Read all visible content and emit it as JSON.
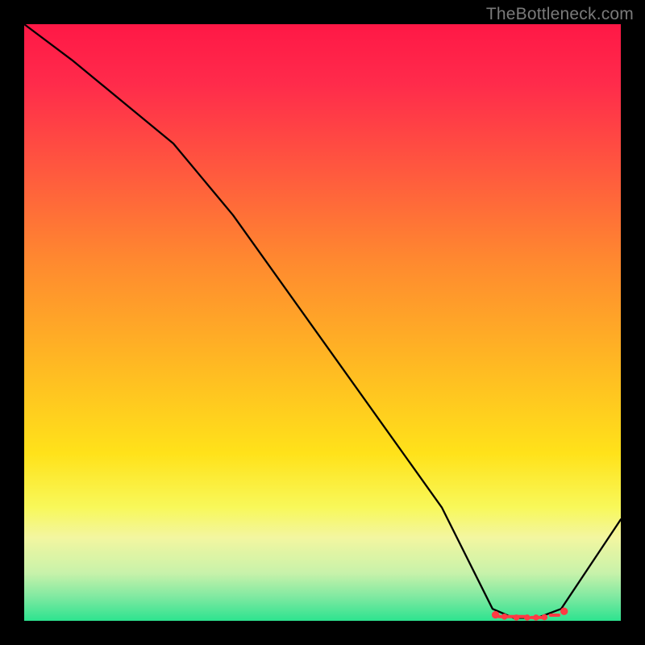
{
  "watermark": "TheBottleneck.com",
  "chart_data": {
    "type": "line",
    "title": "",
    "xlabel": "",
    "ylabel": "",
    "xlim": [
      0,
      100
    ],
    "ylim": [
      0,
      100
    ],
    "grid": false,
    "legend": false,
    "background_gradient": {
      "direction": "vertical",
      "stops": [
        {
          "pos": 0.0,
          "color": "#ff1846"
        },
        {
          "pos": 0.55,
          "color": "#ffe21a"
        },
        {
          "pos": 0.86,
          "color": "#f3f6a0"
        },
        {
          "pos": 1.0,
          "color": "#2de38f"
        }
      ]
    },
    "series": [
      {
        "name": "curve",
        "x": [
          0,
          8,
          25,
          35,
          50,
          60,
          70,
          78.5,
          82,
          86,
          90,
          100
        ],
        "values": [
          100,
          94,
          80,
          68,
          47,
          33,
          19,
          2,
          0.5,
          0.5,
          2,
          17
        ]
      }
    ],
    "markers": {
      "name": "highlight-segment",
      "color": "#ff3b44",
      "points_x": [
        79,
        80.5,
        82.5,
        84.3,
        85.8,
        87.2,
        90.5
      ],
      "points_y": [
        1.0,
        0.7,
        0.55,
        0.55,
        0.55,
        0.6,
        1.6
      ],
      "dashes": [
        {
          "x1": 79.6,
          "x2": 83.9,
          "y": 0.7
        },
        {
          "x1": 85.0,
          "x2": 86.8,
          "y": 0.55
        },
        {
          "x1": 88.2,
          "x2": 89.6,
          "y": 0.95
        }
      ]
    }
  }
}
